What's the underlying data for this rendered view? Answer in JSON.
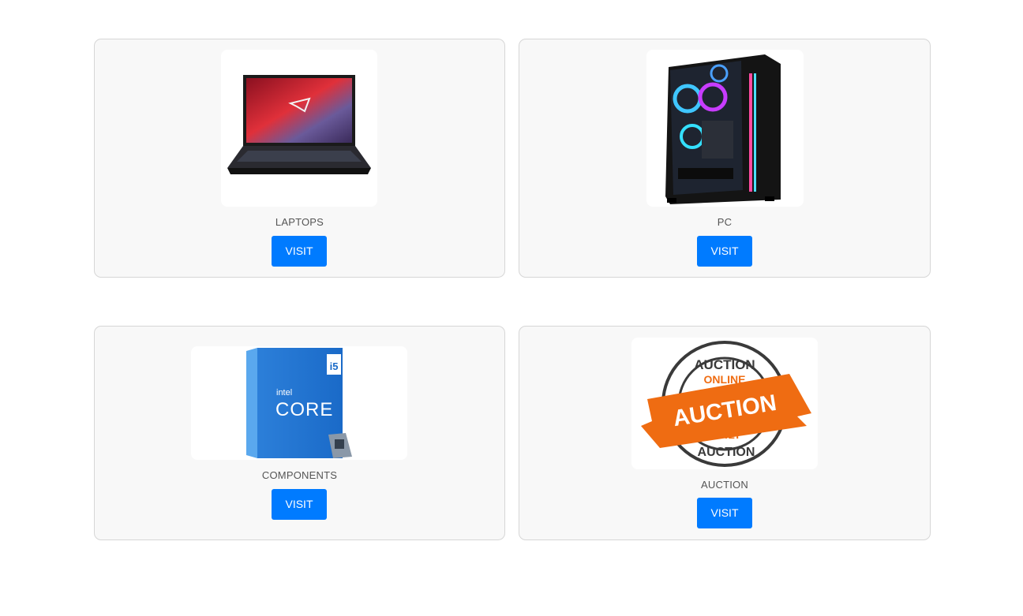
{
  "categories": [
    {
      "title": "LAPTOPS",
      "button_label": "VISIT",
      "image_icon": "laptop-image"
    },
    {
      "title": "PC",
      "button_label": "VISIT",
      "image_icon": "pc-tower-image"
    },
    {
      "title": "COMPONENTS",
      "button_label": "VISIT",
      "image_icon": "cpu-box-image"
    },
    {
      "title": "AUCTION",
      "button_label": "VISIT",
      "image_icon": "auction-stamp-image"
    }
  ],
  "images": {
    "laptop_logo_text": "",
    "cpu_brand": "intel",
    "cpu_product": "CORE",
    "cpu_tier": "i5",
    "stamp_top": "AUCTION",
    "stamp_online": "ONLINE",
    "stamp_main": "AUCTION",
    "stamp_only": "ONLY",
    "stamp_bottom": "AUCTION"
  },
  "colors": {
    "button": "#007bff",
    "card_bg": "#f8f8f8",
    "card_border": "#d6d6d6",
    "auction_orange": "#ef6c12"
  }
}
